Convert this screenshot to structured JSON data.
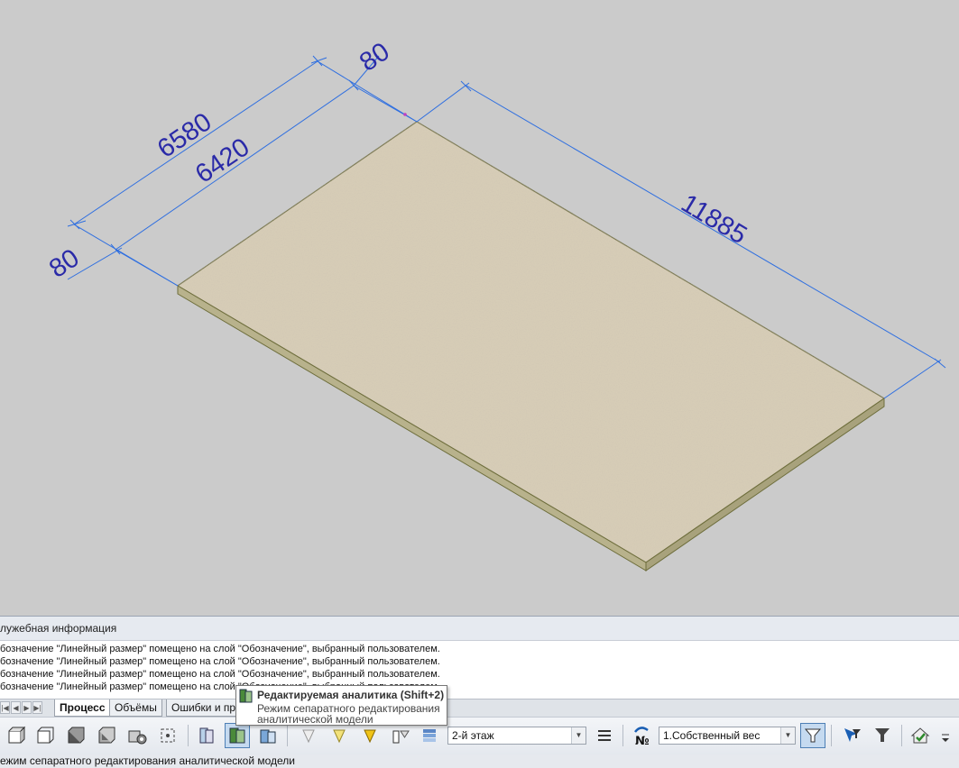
{
  "colors": {
    "viewport_bg": "#cbcbcb",
    "dimension_line": "#2f6fe0",
    "dimension_text": "#2a2aa8",
    "slab_top": "#d9cfb8",
    "slab_edge": "#6e6e3c",
    "toolbar_pressed": "#c5daf0"
  },
  "model": {
    "dimensions": [
      {
        "id": "dim-6580",
        "label": "6580"
      },
      {
        "id": "dim-6420",
        "label": "6420"
      },
      {
        "id": "dim-80-left",
        "label": "80"
      },
      {
        "id": "dim-80-top",
        "label": "80"
      },
      {
        "id": "dim-11885",
        "label": "11885"
      }
    ]
  },
  "service_panel": {
    "title": "лужебная информация",
    "messages": [
      "бозначение \"Линейный размер\" помещено на слой \"Обозначение\", выбранный пользователем.",
      "бозначение \"Линейный размер\" помещено на слой \"Обозначение\", выбранный пользователем.",
      "бозначение \"Линейный размер\" помещено на слой \"Обозначение\", выбранный пользователем.",
      "бозначение \"Линейный размер\" помещено на слой \"Обозначение\", выбранный пользователем."
    ]
  },
  "tabs": [
    {
      "label": "Процесс",
      "active": true
    },
    {
      "label": "Объёмы",
      "active": false
    },
    {
      "label": "Ошибки и пр",
      "active": false
    }
  ],
  "tooltip": {
    "title": "Редактируемая аналитика (Shift+2)",
    "description": "Режим сепаратного редактирования аналитической модели"
  },
  "toolbar": {
    "floor_select": "2-й этаж",
    "load_case_select": "1.Собственный вес",
    "icons": [
      "view-top-icon",
      "view-front-icon",
      "view-side-icon",
      "view-iso-icon",
      "view-settings-icon",
      "zoom-fit-icon",
      "physical-model-icon",
      "analytical-model-icon",
      "separate-edit-icon",
      "light-off-icon",
      "light-on-icon",
      "light-bright-icon",
      "visibility-icon",
      "layers-icon",
      "floor-list-icon",
      "load-number-icon",
      "filter-pressed-icon",
      "select-filter-icon",
      "filter-icon",
      "table-icon",
      "house-check-icon",
      "more-icon"
    ]
  },
  "status_bar": {
    "text": "ежим сепаратного редактирования аналитической модели"
  }
}
